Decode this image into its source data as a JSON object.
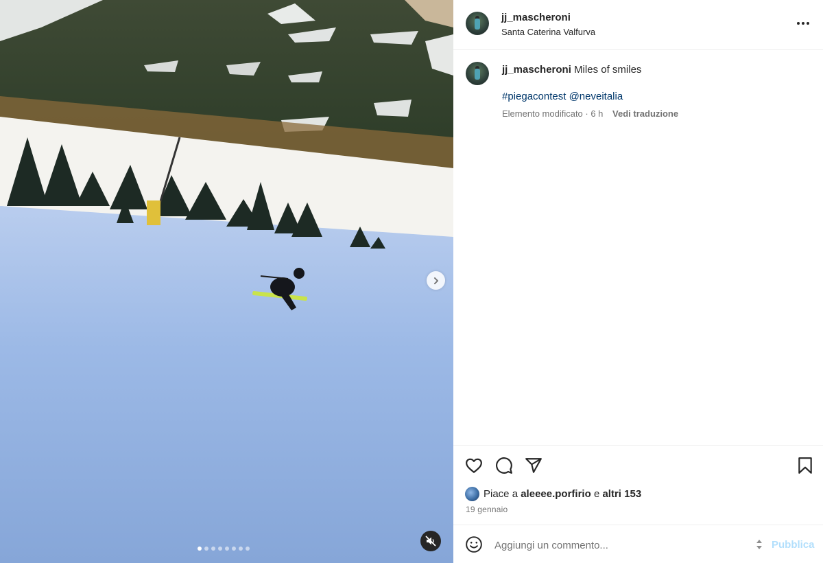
{
  "post": {
    "username": "jj_mascheroni",
    "location": "Santa Caterina Valfurva",
    "caption_user": "jj_mascheroni",
    "caption_text": "Miles of smiles",
    "hashtag": "#piegacontest",
    "mention": "@neveitalia",
    "meta": "Elemento modificato · 6 h",
    "translate_label": "Vedi traduzione",
    "likes_prefix": "Piace a",
    "likes_user": "aleeee.porfirio",
    "likes_conj": "e",
    "likes_others": "altri 153",
    "date": "19 gennaio"
  },
  "media": {
    "carousel_total": 8,
    "carousel_active": 1
  },
  "comment": {
    "placeholder": "Aggiungi un commento...",
    "publish_label": "Pubblica"
  },
  "colors": {
    "link": "#00376b",
    "publish_disabled": "#b2dffc",
    "snow": "#8fb0df"
  },
  "icons": [
    "heart-icon",
    "comment-icon",
    "share-icon",
    "bookmark-icon",
    "emoji-icon",
    "chevron-right-icon",
    "muted-speaker-icon",
    "more-icon",
    "sort-arrows-icon"
  ]
}
